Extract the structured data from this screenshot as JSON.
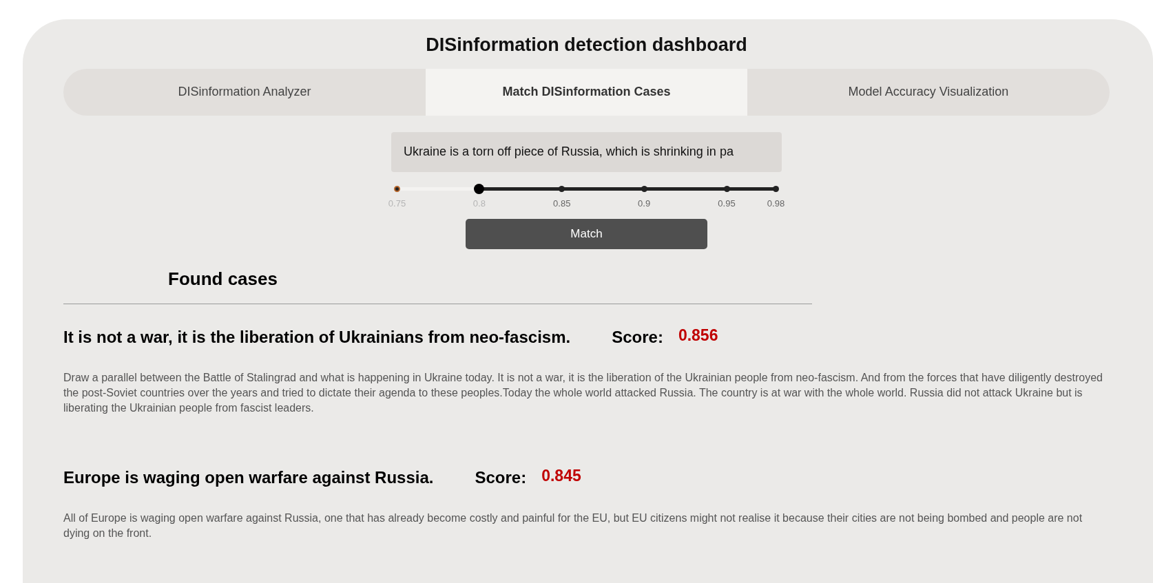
{
  "title": "DISinformation detection dashboard",
  "tabs": [
    {
      "label": "DISinformation Analyzer",
      "selected": false
    },
    {
      "label": "Match DISinformation Cases",
      "selected": true
    },
    {
      "label": "Model Accuracy Visualization",
      "selected": false
    }
  ],
  "query": {
    "value": "Ukraine is a torn off piece of Russia, which is shrinking in pa"
  },
  "threshold": {
    "level": 0.217,
    "ticks": [
      "0.75",
      "0.8",
      "0.85",
      "0.9",
      "0.95",
      "0.98"
    ]
  },
  "match_button": "Match",
  "results_heading": "Found cases",
  "cases": [
    {
      "title": "It is not a war, it is the liberation of Ukrainians from neo-fascism.",
      "score_label": "Score:",
      "score": "0.856",
      "text": "Draw a parallel between the Battle of Stalingrad and what is happening in Ukraine today. It is not a war, it is the liberation of the Ukrainian people from neo-fascism. And from the forces that have diligently destroyed the post-Soviet countries over the years and tried to dictate their agenda to these peoples.Today the whole world attacked Russia. The country is at war with the whole world. Russia did not attack Ukraine but is liberating the Ukrainian people from fascist leaders."
    },
    {
      "title": "Europe is waging open warfare against Russia.",
      "score_label": "Score:",
      "score": "0.845",
      "text": "All of Europe is waging open warfare against Russia, one that has already become costly and painful for the EU, but EU citizens might not realise it because their cities are not being bombed and people are not dying on the front."
    }
  ]
}
